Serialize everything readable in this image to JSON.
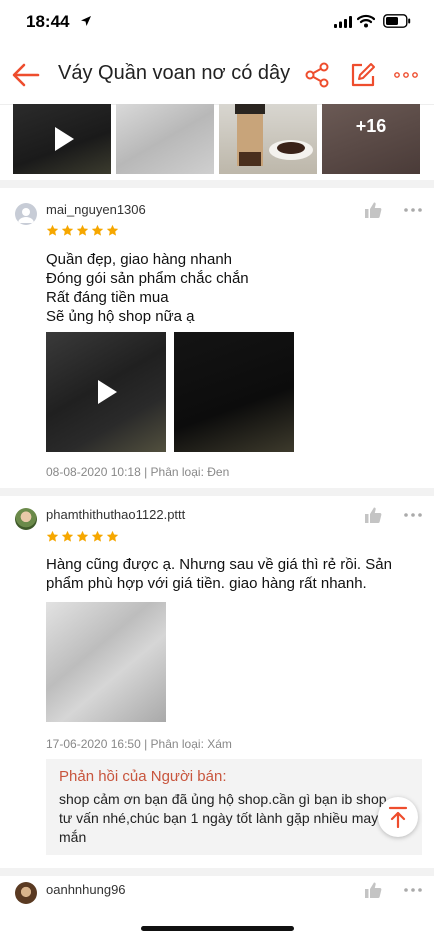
{
  "status": {
    "time": "18:44"
  },
  "header": {
    "title": "Váy Quần voan nơ có dây buộc"
  },
  "thumbs": {
    "more_count": "+16"
  },
  "reviews": [
    {
      "username": "mai_nguyen1306",
      "rating": 5,
      "text_lines": [
        "Quần đẹp, giao hàng nhanh",
        "Đóng gói sản phẩm chắc chắn",
        "Rất đáng tiền mua",
        "Sẽ ủng hộ shop nữa ạ"
      ],
      "meta": "08-08-2020 10:18 | Phân loại: Đen"
    },
    {
      "username": "phamthithuthao1122.pttt",
      "rating": 5,
      "text": "Hàng cũng được ạ. Nhưng sau về giá thì rẻ rồi. Sản phẩm phù hợp với giá tiền. giao hàng rất nhanh.",
      "meta": "17-06-2020 16:50 | Phân loại: Xám",
      "reply": {
        "title": "Phản hồi của Người bán:",
        "text": "shop cảm ơn bạn đã ủng hộ shop.cần gì bạn ib shop tư vấn nhé,chúc bạn 1 ngày tốt lành gặp nhiều may mắn"
      }
    },
    {
      "username": "oanhnhung96"
    }
  ],
  "colors": {
    "accent": "#ee4d2d",
    "star": "#f6a700",
    "reply_title": "#c8553d"
  }
}
